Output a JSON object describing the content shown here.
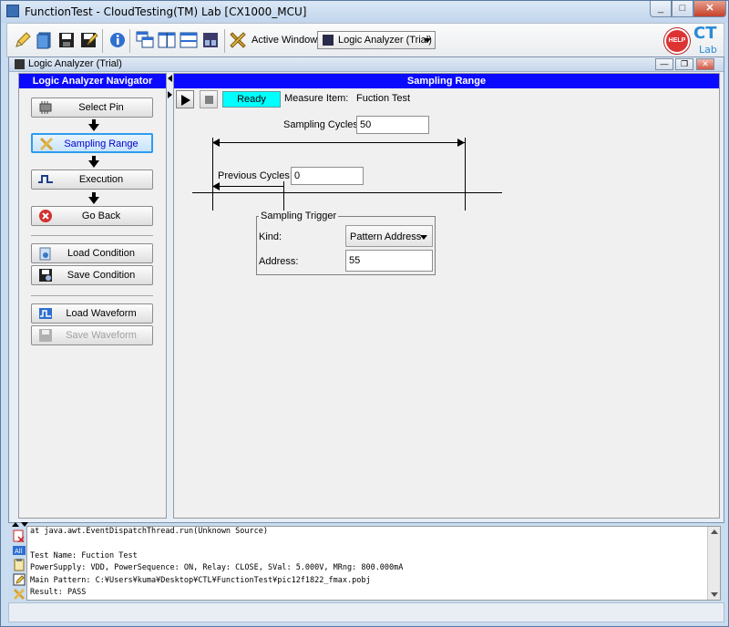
{
  "window": {
    "title": "FunctionTest - CloudTesting(TM) Lab   [CX1000_MCU]",
    "controls": {
      "minimize": "_",
      "maximize": "□",
      "close": "✕"
    }
  },
  "toolbar": {
    "active_window_label": "Active Window:",
    "active_window_value": "Analyzer (Trial)",
    "active_window_prefix": "Logic",
    "help_badge": "HELP",
    "logo_text": "CT",
    "logo_sub": "Lab"
  },
  "frame": {
    "title": "Logic Analyzer (Trial)",
    "controls": {
      "minimize": "—",
      "restore": "❐",
      "close": "✕"
    }
  },
  "navigator": {
    "header": "Logic Analyzer Navigator",
    "buttons": {
      "select_pin": "Select Pin",
      "sampling_range": "Sampling Range",
      "execution": "Execution",
      "go_back": "Go Back",
      "load_condition": "Load Condition",
      "save_condition": "Save Condition",
      "load_waveform": "Load Waveform",
      "save_waveform": "Save Waveform"
    }
  },
  "panel": {
    "header": "Sampling Range",
    "status": "Ready",
    "measure_item_label": "Measure Item:",
    "measure_item_value": "Fuction Test",
    "sampling_cycles_label": "Sampling Cycles:",
    "sampling_cycles_value": "50",
    "previous_cycles_label": "Previous Cycles:",
    "previous_cycles_value": "0",
    "trigger_title": "Sampling Trigger",
    "kind_label": "Kind:",
    "kind_value": "Pattern Address",
    "address_label": "Address:",
    "address_value": "55"
  },
  "log": {
    "lines": [
      "         at java.awt.EventDispatchThread.run(Unknown Source)",
      "",
      "Test Name: Fuction Test",
      "PowerSupply: VDD, PowerSequence: ON, Relay: CLOSE, SVal: 5.000V, MRng: 800.000mA",
      "Main Pattern: C:¥Users¥kuma¥Desktop¥CTL¥FunctionTest¥pic12f1822_fmax.pobj",
      "Result: PASS"
    ]
  }
}
